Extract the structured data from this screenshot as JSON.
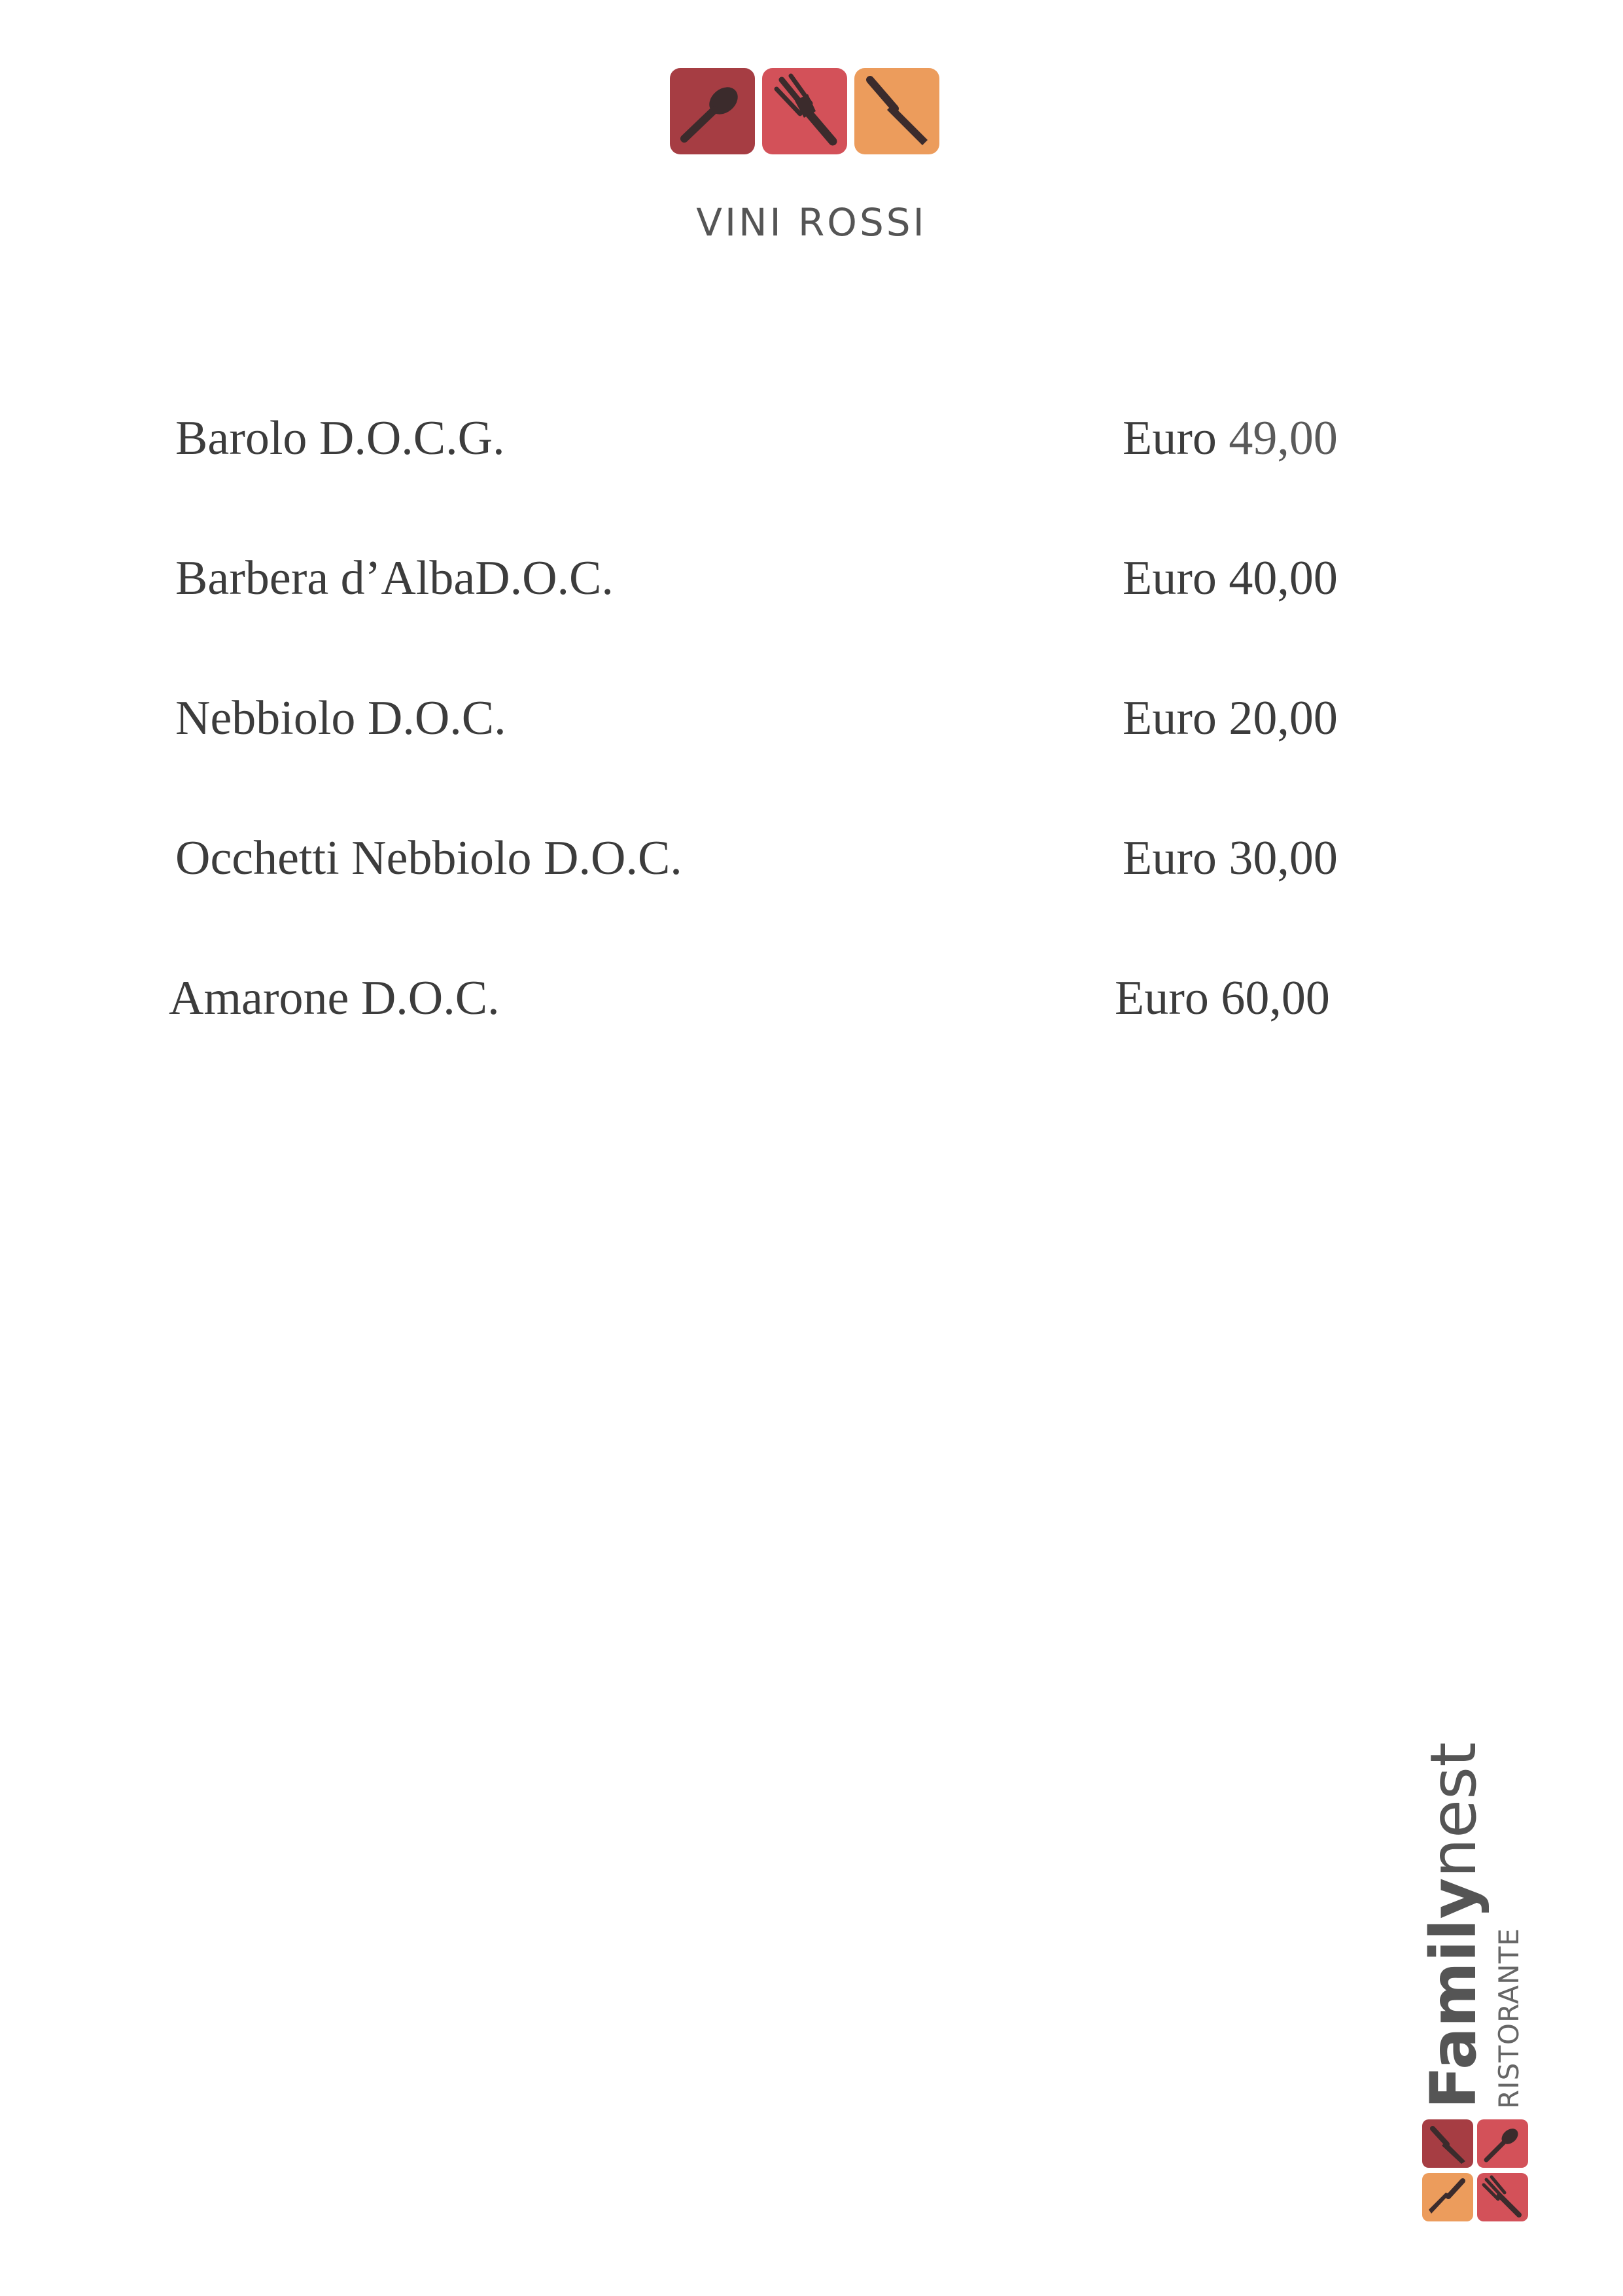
{
  "header": {
    "section_title": "VINI ROSSI",
    "logo_icons": [
      "spoon-icon",
      "fork-icon",
      "knife-icon"
    ],
    "logo_colors": [
      "#a63d43",
      "#d35159",
      "#ec9c5c"
    ]
  },
  "wines": [
    {
      "name": "Barolo D.O.C.G.",
      "currency": "Euro",
      "price": "49,00"
    },
    {
      "name": "Barbera d’AlbaD.O.C.",
      "currency": "Euro",
      "price": "40,00"
    },
    {
      "name": "Nebbiolo D.O.C.",
      "currency": "Euro",
      "price": "20,00"
    },
    {
      "name": "Occhetti Nebbiolo D.O.C.",
      "currency": "Euro",
      "price": "30,00"
    },
    {
      "name": "Amarone D.O.C.",
      "currency": "Euro",
      "price": "60,00"
    }
  ],
  "brand": {
    "name_bold": "Family",
    "name_light": "nest",
    "subtitle": "RISTORANTE"
  }
}
